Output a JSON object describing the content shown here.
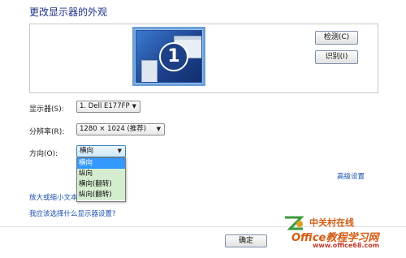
{
  "title": "更改显示器的外观",
  "preview": {
    "monitor_number": "1"
  },
  "buttons": {
    "detect": "检测(C)",
    "identify": "识别(I)",
    "ok": "确定"
  },
  "fields": {
    "display_label": "显示器(S):",
    "display_value": "1. Dell E177FP",
    "resolution_label": "分辨率(R):",
    "resolution_value": "1280 × 1024 (推荐)",
    "orientation_label": "方向(O):",
    "orientation_value": "横向"
  },
  "orientation_options": [
    "横向",
    "纵向",
    "横向(翻转)",
    "纵向(翻转)"
  ],
  "links": {
    "advanced": "高级设置",
    "enlarge_text": "放大或缩小文本",
    "which_settings": "我应该选择什么显示器设置?"
  },
  "watermark": {
    "site_cn": "中关村在线",
    "brand": "Office教程学习网",
    "url": "www.office68.com"
  },
  "colors": {
    "title": "#1e3287",
    "link": "#1a4fb0",
    "selection": "#3399ff",
    "watermark": "#d45a10"
  }
}
